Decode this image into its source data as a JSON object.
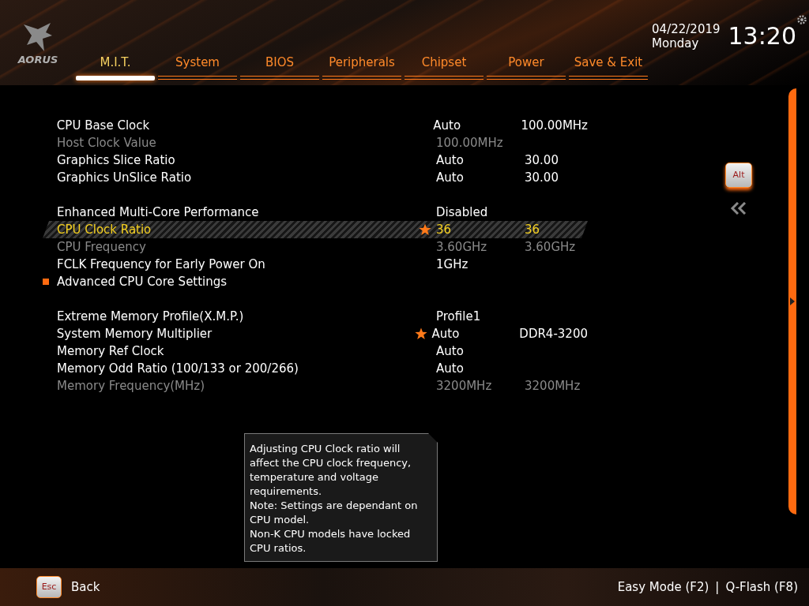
{
  "brand": "AORUS",
  "tabs": [
    {
      "label": "M.I.T.",
      "selected": true
    },
    {
      "label": "System",
      "selected": false
    },
    {
      "label": "BIOS",
      "selected": false
    },
    {
      "label": "Peripherals",
      "selected": false
    },
    {
      "label": "Chipset",
      "selected": false
    },
    {
      "label": "Power",
      "selected": false
    },
    {
      "label": "Save & Exit",
      "selected": false
    }
  ],
  "date": "04/22/2019",
  "day": "Monday",
  "time": "13:20",
  "sections": [
    {
      "rows": [
        {
          "kind": "setting",
          "label": "CPU Base Clock",
          "value": "Auto",
          "current": "100.00MHz",
          "disabled": false,
          "selected": false,
          "starred": false
        },
        {
          "kind": "setting",
          "label": "Host Clock Value",
          "value": "100.00MHz",
          "disabled": true,
          "selected": false,
          "starred": false
        },
        {
          "kind": "setting",
          "label": "Graphics Slice Ratio",
          "value": "Auto",
          "current": "30.00",
          "disabled": false,
          "selected": false,
          "starred": false
        },
        {
          "kind": "setting",
          "label": "Graphics UnSlice Ratio",
          "value": "Auto",
          "current": "30.00",
          "disabled": false,
          "selected": false,
          "starred": false
        }
      ]
    },
    {
      "rows": [
        {
          "kind": "setting",
          "label": "Enhanced Multi-Core Performance",
          "value": "Disabled",
          "disabled": false,
          "selected": false,
          "starred": false
        },
        {
          "kind": "setting",
          "label": "CPU Clock Ratio",
          "value": "36",
          "current": "36",
          "disabled": false,
          "selected": true,
          "starred": true
        },
        {
          "kind": "setting",
          "label": "CPU Frequency",
          "value": "3.60GHz",
          "current": "3.60GHz",
          "disabled": true,
          "selected": false,
          "starred": false
        },
        {
          "kind": "setting",
          "label": "FCLK Frequency for Early Power On",
          "value": "1GHz",
          "disabled": false,
          "selected": false,
          "starred": false
        },
        {
          "kind": "submenu",
          "label": "Advanced CPU Core Settings",
          "disabled": false,
          "selected": false,
          "starred": false
        }
      ]
    },
    {
      "rows": [
        {
          "kind": "setting",
          "label": "Extreme Memory Profile(X.M.P.)",
          "value": "Profile1",
          "disabled": false,
          "selected": false,
          "starred": false
        },
        {
          "kind": "setting",
          "label": "System Memory Multiplier",
          "value": "Auto",
          "current": "DDR4-3200",
          "disabled": false,
          "selected": false,
          "starred": true
        },
        {
          "kind": "setting",
          "label": "Memory Ref Clock",
          "value": "Auto",
          "disabled": false,
          "selected": false,
          "starred": false
        },
        {
          "kind": "setting",
          "label": "Memory Odd Ratio (100/133 or 200/266)",
          "value": "Auto",
          "disabled": false,
          "selected": false,
          "starred": false
        },
        {
          "kind": "setting",
          "label": "Memory Frequency(MHz)",
          "value": "3200MHz",
          "current": "3200MHz",
          "disabled": true,
          "selected": false,
          "starred": false
        }
      ]
    }
  ],
  "help": "Adjusting CPU Clock ratio will affect the CPU clock frequency, temperature and voltage requirements.\nNote: Settings are dependant  on  CPU model.\nNon-K CPU models have locked CPU ratios.",
  "alt_key": "Alt",
  "footer": {
    "key": "Esc",
    "label": "Back",
    "shortcuts": [
      "Easy Mode (F2)",
      "|",
      "Q-Flash (F8)"
    ]
  }
}
